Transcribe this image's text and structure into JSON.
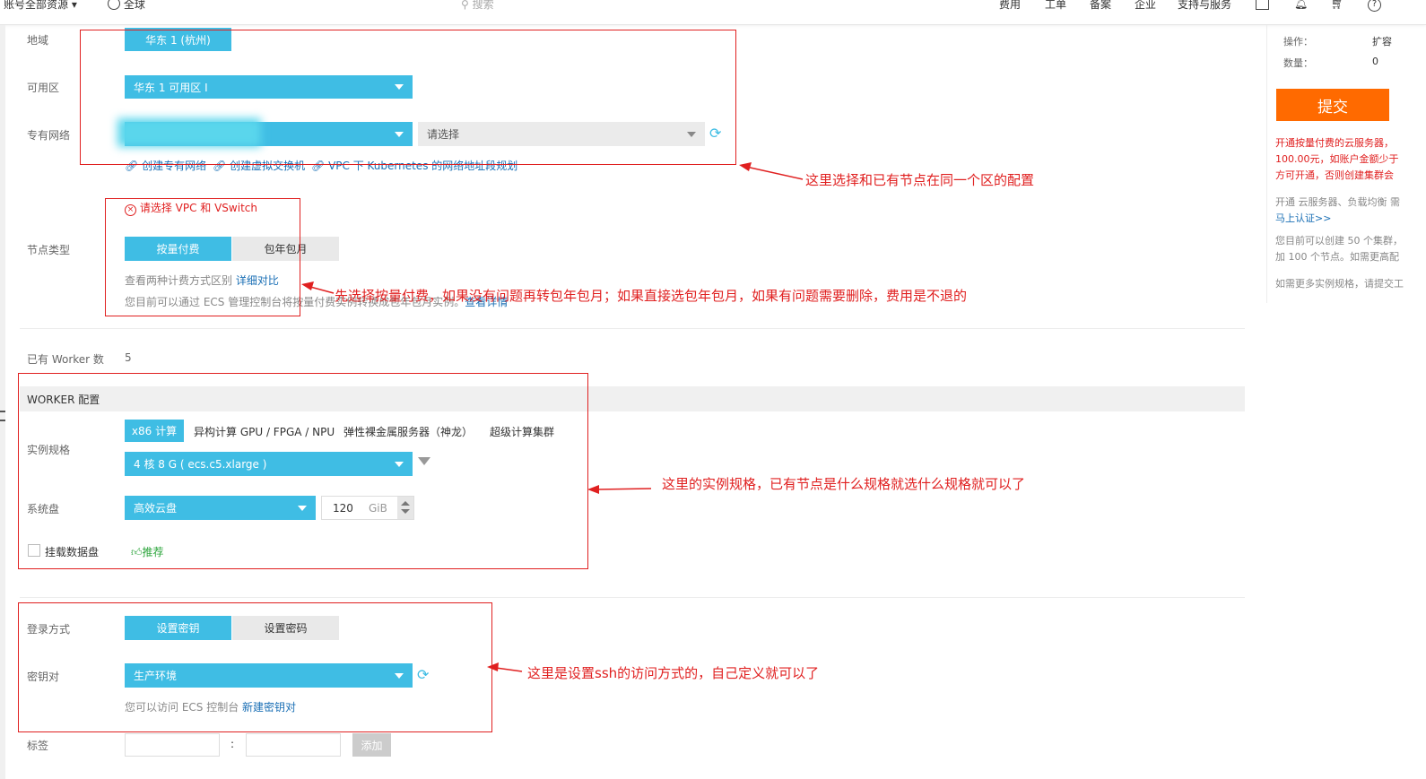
{
  "topbar": {
    "account_label": "账号全部资源",
    "region_label": "全球",
    "search_placeholder": "搜索",
    "nav": [
      "费用",
      "工单",
      "备案",
      "企业",
      "支持与服务"
    ]
  },
  "form": {
    "region": {
      "label": "地域",
      "value": "华东 1 (杭州)"
    },
    "zone": {
      "label": "可用区",
      "value": "华东 1 可用区 I"
    },
    "vpc": {
      "label": "专有网络",
      "vswitch_placeholder": "请选择",
      "links": [
        "创建专有网络",
        "创建虚拟交换机",
        "VPC 下 Kubernetes 的网络地址段规划"
      ]
    },
    "vpc_error": "请选择 VPC 和 VSwitch",
    "node_type": {
      "label": "节点类型",
      "options": [
        "按量付费",
        "包年包月"
      ],
      "hint": "查看两种计费方式区别",
      "hint_link": "详细对比",
      "hint2": "您目前可以通过 ECS 管理控制台将按量付费实例转换成包年包月实例。",
      "hint2_link": "查看详情"
    },
    "existing_workers": {
      "label": "已有 Worker 数",
      "value": "5"
    },
    "worker_section_title": "WORKER 配置",
    "instance_spec": {
      "label": "实例规格",
      "tabs": [
        "x86 计算",
        "异构计算 GPU / FPGA / NPU",
        "弹性裸金属服务器（神龙）",
        "超级计算集群"
      ],
      "value": "4 核 8 G ( ecs.c5.xlarge )"
    },
    "system_disk": {
      "label": "系统盘",
      "type": "高效云盘",
      "size": "120",
      "unit": "GiB"
    },
    "data_disk": {
      "label": "挂载数据盘",
      "recommend": "推荐"
    },
    "login": {
      "label": "登录方式",
      "options": [
        "设置密钥",
        "设置密码"
      ]
    },
    "keypair": {
      "label": "密钥对",
      "value": "生产环境",
      "hint": "您可以访问 ECS 控制台",
      "hint_link": "新建密钥对"
    },
    "tags": {
      "label": "标签",
      "separator": ":",
      "add_label": "添加"
    }
  },
  "summary": {
    "operation_label": "操作：",
    "operation_value": "扩容",
    "count_label": "数量：",
    "count_value": "0",
    "submit_label": "提交",
    "notice_red": [
      "开通按量付费的云服务器，",
      "100.00元，如账户金额少于",
      "方可开通，否则创建集群会"
    ],
    "notice_grey": "开通 云服务器、负载均衡 需",
    "verify_link": "马上认证>>",
    "quota": [
      "您目前可以创建 50 个集群，",
      "加 100 个节点。如需更高配"
    ],
    "more": "如需更多实例规格，请提交工"
  },
  "annotations": {
    "a1": "这里选择和已有节点在同一个区的配置",
    "a2": "先选择按量付费，如果没有问题再转包年包月；如果直接选包年包月，如果有问题需要删除，费用是不退的",
    "a3": "这里的实例规格，已有节点是什么规格就选什么规格就可以了",
    "a4": "这里是设置ssh的访问方式的，自己定义就可以了"
  },
  "colors": {
    "accent": "#3fbde4",
    "submit": "#ff6a00",
    "annotation": "#e02020",
    "link": "#1a6fb5"
  }
}
